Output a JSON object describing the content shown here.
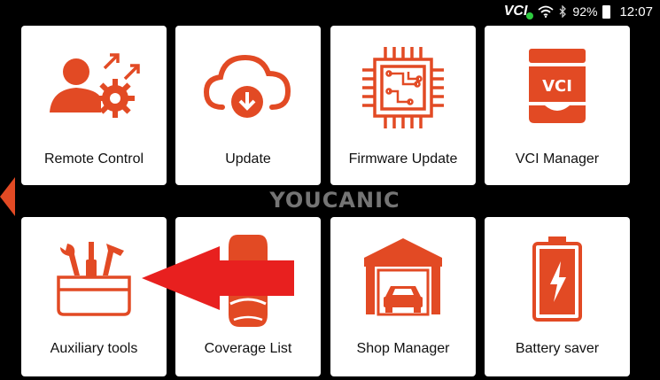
{
  "status_bar": {
    "vci_label": "VCI",
    "battery_percent": "92%",
    "time": "12:07",
    "icons": [
      "wifi-icon",
      "bluetooth-icon",
      "battery-icon"
    ]
  },
  "tiles": [
    {
      "label": "Remote Control",
      "icon": "remote-control-icon"
    },
    {
      "label": "Update",
      "icon": "cloud-update-icon"
    },
    {
      "label": "Firmware Update",
      "icon": "chip-icon"
    },
    {
      "label": "VCI Manager",
      "icon": "vci-device-icon"
    },
    {
      "label": "Auxiliary tools",
      "icon": "toolbox-icon"
    },
    {
      "label": "Coverage List",
      "icon": "coverage-icon"
    },
    {
      "label": "Shop Manager",
      "icon": "garage-icon"
    },
    {
      "label": "Battery saver",
      "icon": "battery-saver-icon"
    }
  ],
  "vci_device_text": "VCI",
  "watermark": "YOUCANIC",
  "colors": {
    "accent": "#e24a24",
    "highlight_arrow": "#e8201f",
    "background": "#000000"
  }
}
